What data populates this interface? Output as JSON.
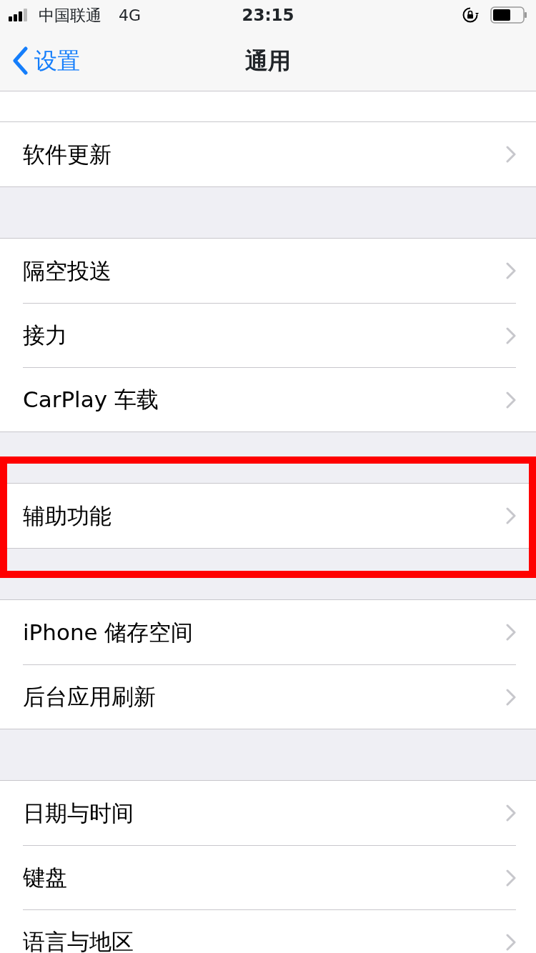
{
  "status_bar": {
    "carrier": "中国联通",
    "network": "4G",
    "time": "23:15"
  },
  "nav": {
    "back": "设置",
    "title": "通用"
  },
  "sections": [
    {
      "highlighted": false,
      "rows": [
        {
          "label": "软件更新"
        }
      ]
    },
    {
      "highlighted": false,
      "rows": [
        {
          "label": "隔空投送"
        },
        {
          "label": "接力"
        },
        {
          "label": "CarPlay 车载"
        }
      ]
    },
    {
      "highlighted": true,
      "rows": [
        {
          "label": "辅助功能"
        }
      ]
    },
    {
      "highlighted": false,
      "rows": [
        {
          "label": "iPhone 储存空间"
        },
        {
          "label": "后台应用刷新"
        }
      ]
    },
    {
      "highlighted": false,
      "rows": [
        {
          "label": "日期与时间"
        },
        {
          "label": "键盘"
        },
        {
          "label": "语言与地区"
        }
      ]
    }
  ]
}
